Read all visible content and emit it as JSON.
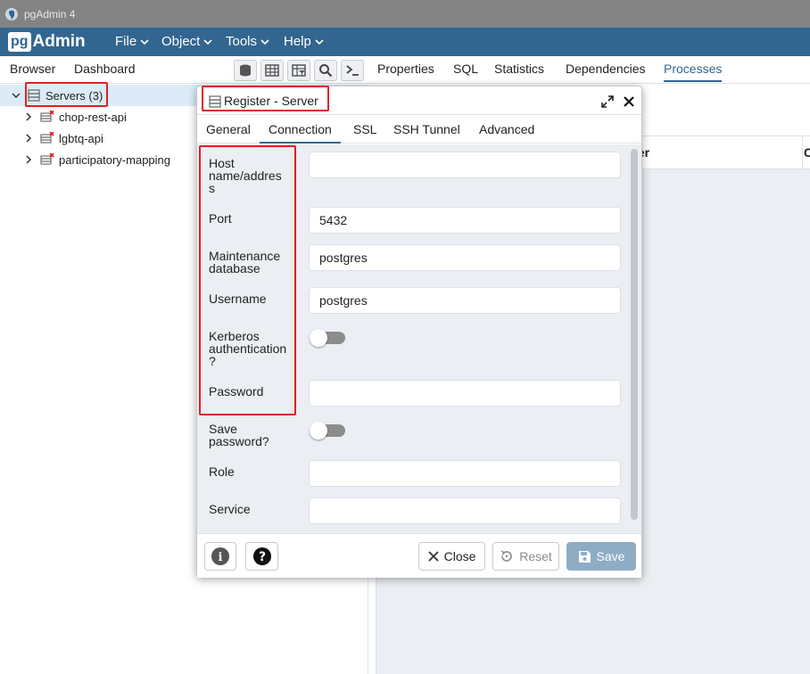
{
  "window": {
    "title": "pgAdmin 4"
  },
  "logo": {
    "pg": "pg",
    "admin": "Admin"
  },
  "menu": [
    {
      "label": "File"
    },
    {
      "label": "Object"
    },
    {
      "label": "Tools"
    },
    {
      "label": "Help"
    }
  ],
  "left_tabs": {
    "browser": "Browser",
    "dashboard": "Dashboard"
  },
  "tree": {
    "root": {
      "label": "Servers (3)"
    },
    "items": [
      {
        "label": "chop-rest-api"
      },
      {
        "label": "lgbtq-api"
      },
      {
        "label": "participatory-mapping"
      }
    ]
  },
  "right_tabs": [
    {
      "label": "Properties"
    },
    {
      "label": "SQL"
    },
    {
      "label": "Statistics"
    },
    {
      "label": "Dependencies"
    },
    {
      "label": "Processes"
    }
  ],
  "grid": {
    "col_server": "ver",
    "col_next": "C"
  },
  "dialog": {
    "title": "Register - Server",
    "tabs": [
      {
        "label": "General"
      },
      {
        "label": "Connection"
      },
      {
        "label": "SSL"
      },
      {
        "label": "SSH Tunnel"
      },
      {
        "label": "Advanced"
      }
    ],
    "fields": {
      "host": {
        "label": "Host name/address",
        "value": ""
      },
      "port": {
        "label": "Port",
        "value": "5432"
      },
      "maintenance_db": {
        "label": "Maintenance database",
        "value": "postgres"
      },
      "username": {
        "label": "Username",
        "value": "postgres"
      },
      "kerberos": {
        "label": "Kerberos authentication?",
        "on": false
      },
      "password": {
        "label": "Password",
        "value": ""
      },
      "save_password": {
        "label": "Save password?",
        "on": false
      },
      "role": {
        "label": "Role",
        "value": ""
      },
      "service": {
        "label": "Service",
        "value": ""
      }
    },
    "buttons": {
      "info": "i",
      "help": "?",
      "close": "Close",
      "reset": "Reset",
      "save": "Save"
    }
  },
  "colors": {
    "brand": "#326690",
    "annotation": "#e02020",
    "save_button": "#8eadc5"
  }
}
